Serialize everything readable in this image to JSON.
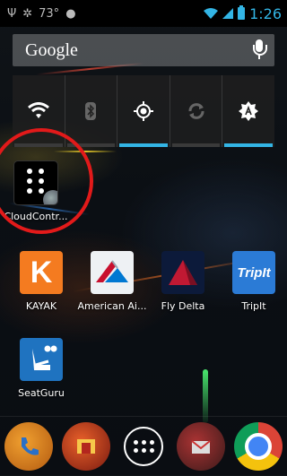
{
  "status_bar": {
    "temperature": "73°",
    "time": "1:26"
  },
  "search": {
    "brand": "Google"
  },
  "power_widget": {
    "items": [
      {
        "name": "wifi-toggle",
        "icon": "wifi-icon",
        "on": false
      },
      {
        "name": "bluetooth-toggle",
        "icon": "bluetooth-icon",
        "on": false
      },
      {
        "name": "gps-toggle",
        "icon": "gps-icon",
        "on": true
      },
      {
        "name": "sync-toggle",
        "icon": "sync-icon",
        "on": false
      },
      {
        "name": "brightness-toggle",
        "icon": "brightness-auto-icon",
        "on": true
      }
    ]
  },
  "apps": [
    {
      "id": "cloudcontrol",
      "label": "CloudContr..."
    },
    {
      "id": "kayak",
      "label": "KAYAK",
      "glyph": "K"
    },
    {
      "id": "american",
      "label": "American Ai..."
    },
    {
      "id": "delta",
      "label": "Fly Delta"
    },
    {
      "id": "tripit",
      "label": "TripIt",
      "glyph": "TripIt"
    },
    {
      "id": "seatguru",
      "label": "SeatGuru"
    }
  ],
  "dock": [
    "phone",
    "launcher",
    "all-apps",
    "mail",
    "chrome"
  ],
  "colors": {
    "accent": "#33b5e5",
    "highlight_circle": "#e21a1a"
  }
}
